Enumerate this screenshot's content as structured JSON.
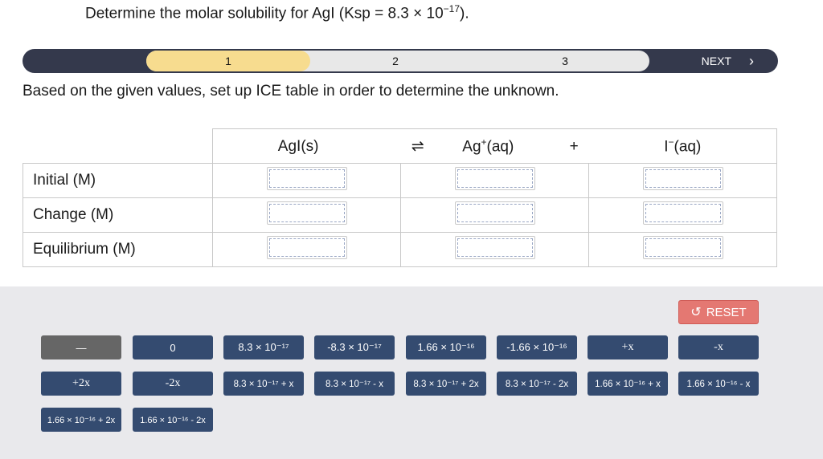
{
  "question": {
    "prefix": "Determine the molar solubility for AgI (Ksp = 8.3 × 10",
    "exponent": "−17",
    "suffix": ")."
  },
  "progress": {
    "steps": [
      "1",
      "2",
      "3"
    ],
    "active_step": "1",
    "next_label": "NEXT",
    "next_icon": "chevron-right-icon"
  },
  "instruction": "Based on the given values, set up ICE table in order to determine the unknown.",
  "ice_table": {
    "headers": {
      "reactant": "AgI(s)",
      "arrow": "⇌",
      "cation_base": "Ag",
      "cation_charge": "+",
      "cation_state": "(aq)",
      "plus": "+",
      "anion_base": "I",
      "anion_charge": "−",
      "anion_state": "(aq)"
    },
    "rows": [
      "Initial (M)",
      "Change (M)",
      "Equilibrium (M)"
    ]
  },
  "palette": {
    "reset_label": "RESET",
    "reset_icon": "undo-icon",
    "tiles": [
      "—",
      "0",
      "8.3 × 10⁻¹⁷",
      "-8.3 × 10⁻¹⁷",
      "1.66 × 10⁻¹⁶",
      "-1.66 × 10⁻¹⁶",
      "+x",
      "-x",
      "+2x",
      "-2x",
      "8.3 × 10⁻¹⁷ + x",
      "8.3 × 10⁻¹⁷ - x",
      "8.3 × 10⁻¹⁷ + 2x",
      "8.3 × 10⁻¹⁷ - 2x",
      "1.66 × 10⁻¹⁶ + x",
      "1.66 × 10⁻¹⁶ - x",
      "1.66 × 10⁻¹⁶ + 2x",
      "1.66 × 10⁻¹⁶ - 2x"
    ]
  },
  "colors": {
    "progress_track": "#34394c",
    "active_step": "#f7dc8f",
    "tile": "#344b70",
    "tile_blank": "#666666",
    "reset": "#e47872",
    "palette_bg": "#e9e9ec"
  }
}
